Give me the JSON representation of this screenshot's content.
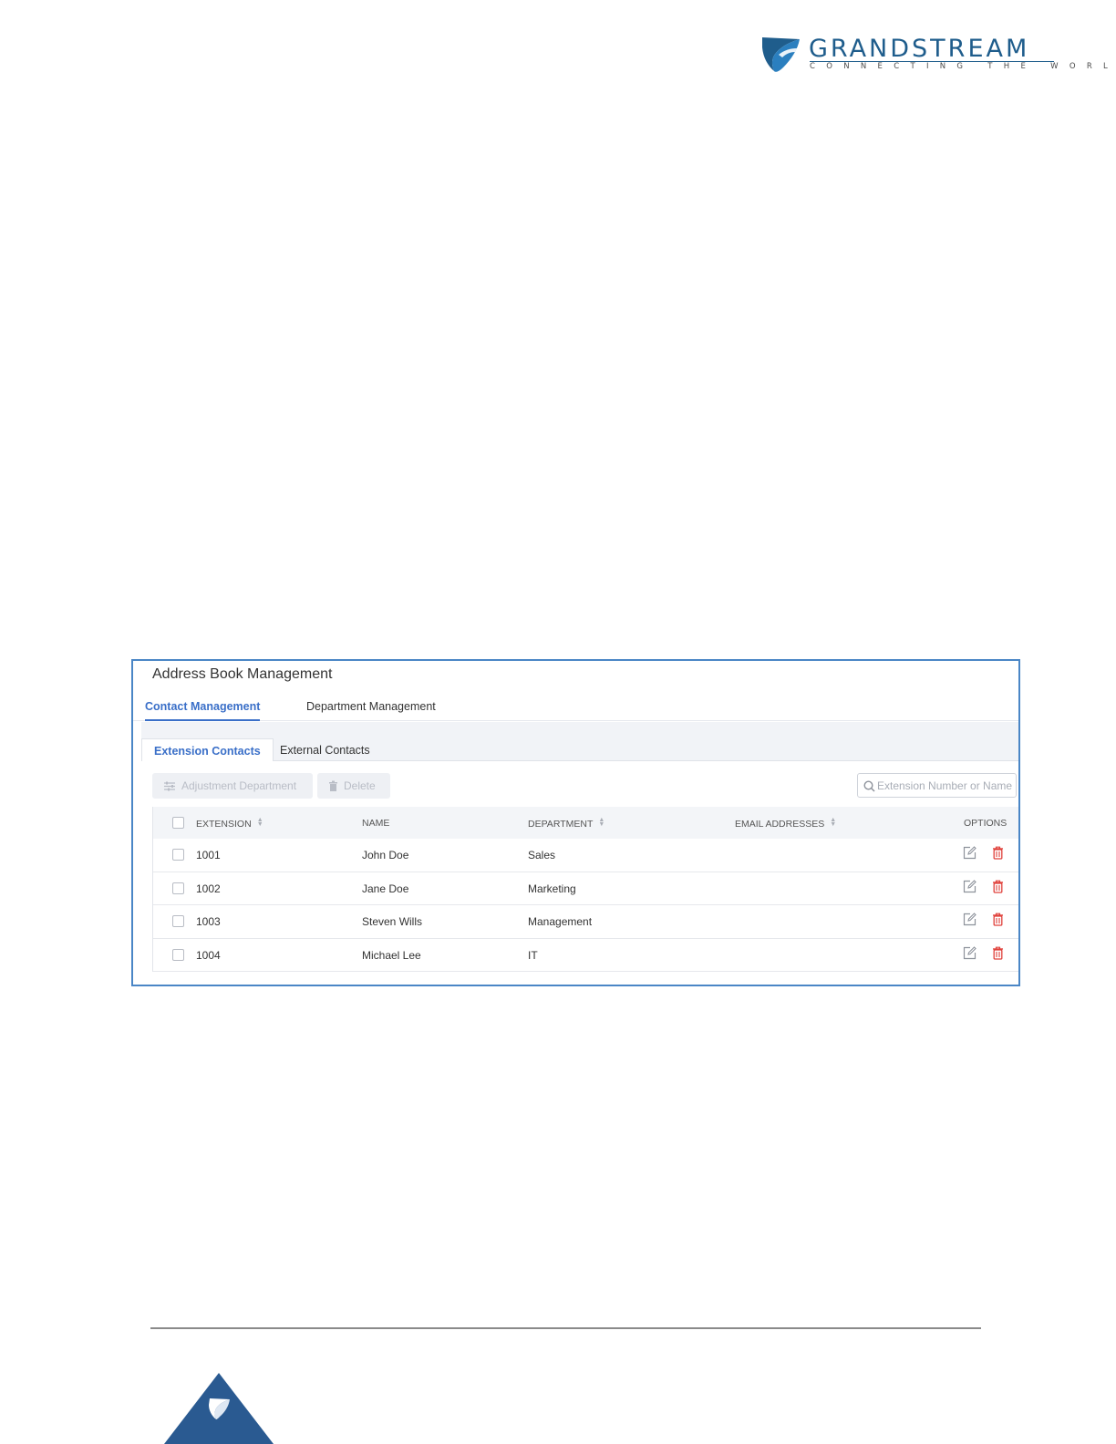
{
  "brand": {
    "name": "GRANDSTREAM",
    "tagline": "CONNECTING THE WORLD",
    "primary_color": "#1f5d8c"
  },
  "screenshot": {
    "title": "Address Book Management",
    "tabs": [
      {
        "label": "Contact Management",
        "active": true
      },
      {
        "label": "Department Management",
        "active": false
      }
    ],
    "sub_tabs": [
      {
        "label": "Extension Contacts",
        "active": true
      },
      {
        "label": "External Contacts",
        "active": false
      }
    ],
    "toolbar": {
      "adjust_label": "Adjustment Department",
      "delete_label": "Delete",
      "search_placeholder": "Extension Number or Name"
    },
    "table": {
      "headers": {
        "extension": "EXTENSION",
        "name": "NAME",
        "department": "DEPARTMENT",
        "email": "EMAIL ADDRESSES",
        "options": "OPTIONS"
      },
      "rows": [
        {
          "extension": "1001",
          "name": "John Doe",
          "department": "Sales",
          "email": ""
        },
        {
          "extension": "1002",
          "name": "Jane Doe",
          "department": "Marketing",
          "email": ""
        },
        {
          "extension": "1003",
          "name": "Steven Wills",
          "department": "Management",
          "email": ""
        },
        {
          "extension": "1004",
          "name": "Michael Lee",
          "department": "IT",
          "email": ""
        }
      ]
    },
    "accent_color": "#3a6fc8",
    "delete_color": "#e0413b"
  }
}
